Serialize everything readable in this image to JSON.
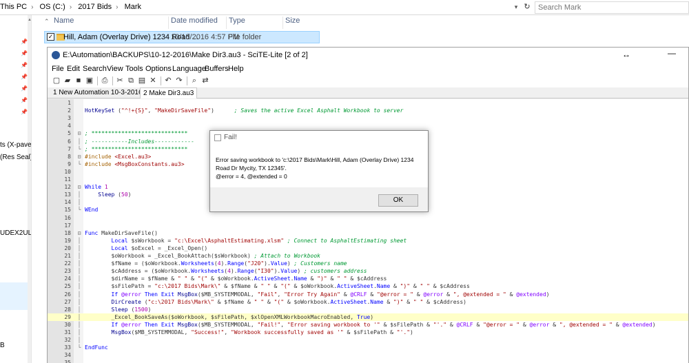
{
  "explorer": {
    "breadcrumbs": [
      "This PC",
      "OS (C:)",
      "2017 Bids",
      "Mark"
    ],
    "search_placeholder": "Search Mark",
    "columns": [
      "Name",
      "Date modified",
      "Type",
      "Size"
    ],
    "files": [
      {
        "name": "Hill, Adam (Overlay Drive) 1234 Road ...",
        "date": "10/13/2016 4:57 PM",
        "type": "File folder"
      }
    ],
    "nav_fragments": [
      "ts (X-pave a",
      "(Res Seal)",
      "UDEX2ULTI",
      "B"
    ]
  },
  "scite": {
    "title": "E:\\Automation\\BACKUPS\\10-12-2016\\Make Dir3.au3 - SciTE-Lite [2 of 2]",
    "menus": [
      "File",
      "Edit",
      "Search",
      "View",
      "Tools",
      "Options",
      "Language",
      "Buffers",
      "Help"
    ],
    "tabs": [
      "1 New Automation 10-3-2016.au3",
      "2 Make Dir3.au3"
    ],
    "active_tab": 1,
    "highlighted_line": 29,
    "lines": [
      {
        "n": "1",
        "fold": "",
        "tokens": []
      },
      {
        "n": "2",
        "fold": "",
        "tokens": [
          [
            "fn",
            "HotKeySet"
          ],
          [
            "txt",
            " ("
          ],
          [
            "str",
            "\"^!+{S}\""
          ],
          [
            "txt",
            ", "
          ],
          [
            "str",
            "\"MakeDirSaveFile\""
          ],
          [
            "txt",
            ")      "
          ],
          [
            "com",
            "; Saves the active Excel Asphalt Workbook to server"
          ]
        ]
      },
      {
        "n": "3",
        "fold": "",
        "tokens": []
      },
      {
        "n": "4",
        "fold": "",
        "tokens": []
      },
      {
        "n": "5",
        "fold": "⊟",
        "tokens": [
          [
            "com",
            "; *****************************"
          ]
        ]
      },
      {
        "n": "6",
        "fold": "│",
        "tokens": [
          [
            "com",
            "; -----------Includes------------"
          ]
        ]
      },
      {
        "n": "7",
        "fold": "└",
        "tokens": [
          [
            "com",
            "; *****************************"
          ]
        ]
      },
      {
        "n": "8",
        "fold": "⊟",
        "tokens": [
          [
            "inc",
            "#include"
          ],
          [
            "txt",
            " "
          ],
          [
            "str",
            "<Excel.au3>"
          ]
        ]
      },
      {
        "n": "9",
        "fold": "└",
        "tokens": [
          [
            "inc",
            "#include"
          ],
          [
            "txt",
            " "
          ],
          [
            "str",
            "<MsgBoxConstants.au3>"
          ]
        ]
      },
      {
        "n": "10",
        "fold": "",
        "tokens": []
      },
      {
        "n": "11",
        "fold": "",
        "tokens": []
      },
      {
        "n": "12",
        "fold": "⊟",
        "tokens": [
          [
            "kw",
            "While"
          ],
          [
            "txt",
            " "
          ],
          [
            "num",
            "1"
          ]
        ]
      },
      {
        "n": "13",
        "fold": "│",
        "tokens": [
          [
            "txt",
            "    "
          ],
          [
            "fn",
            "Sleep"
          ],
          [
            "txt",
            " ("
          ],
          [
            "num",
            "50"
          ],
          [
            "txt",
            ")"
          ]
        ]
      },
      {
        "n": "14",
        "fold": "│",
        "tokens": []
      },
      {
        "n": "15",
        "fold": "└",
        "tokens": [
          [
            "kw",
            "WEnd"
          ]
        ]
      },
      {
        "n": "16",
        "fold": "",
        "tokens": []
      },
      {
        "n": "17",
        "fold": "",
        "tokens": []
      },
      {
        "n": "18",
        "fold": "⊟",
        "tokens": [
          [
            "kw",
            "Func"
          ],
          [
            "txt",
            " MakeDirSaveFile()"
          ]
        ]
      },
      {
        "n": "19",
        "fold": "│",
        "tokens": [
          [
            "txt",
            "        "
          ],
          [
            "kw",
            "Local"
          ],
          [
            "txt",
            " $sWorkbook = "
          ],
          [
            "str",
            "\"c:\\Excel\\AsphaltEstimating.xlsm\""
          ],
          [
            "txt",
            " "
          ],
          [
            "com",
            "; Connect to AsphaltEstimating sheet"
          ]
        ]
      },
      {
        "n": "20",
        "fold": "│",
        "tokens": [
          [
            "txt",
            "        "
          ],
          [
            "kw",
            "Local"
          ],
          [
            "txt",
            " $oExcel = _Excel_Open()"
          ]
        ]
      },
      {
        "n": "21",
        "fold": "│",
        "tokens": [
          [
            "txt",
            "        $oWorkbook = _Excel_BookAttach($sWorkbook) "
          ],
          [
            "com",
            "; Attach to Workbook"
          ]
        ]
      },
      {
        "n": "22",
        "fold": "│",
        "tokens": [
          [
            "txt",
            "        $fName = ($oWorkbook."
          ],
          [
            "kw",
            "Worksheets"
          ],
          [
            "txt",
            "("
          ],
          [
            "num",
            "4"
          ],
          [
            "txt",
            ")."
          ],
          [
            "kw",
            "Range"
          ],
          [
            "txt",
            "("
          ],
          [
            "str",
            "\"J20\""
          ],
          [
            "txt",
            ")."
          ],
          [
            "kw",
            "Value"
          ],
          [
            "txt",
            ") "
          ],
          [
            "com",
            "; Customers name"
          ]
        ]
      },
      {
        "n": "23",
        "fold": "│",
        "tokens": [
          [
            "txt",
            "        $cAddress = ($oWorkbook."
          ],
          [
            "kw",
            "Worksheets"
          ],
          [
            "txt",
            "("
          ],
          [
            "num",
            "4"
          ],
          [
            "txt",
            ")."
          ],
          [
            "kw",
            "Range"
          ],
          [
            "txt",
            "("
          ],
          [
            "str",
            "\"I30\""
          ],
          [
            "txt",
            ")."
          ],
          [
            "kw",
            "Value"
          ],
          [
            "txt",
            ") "
          ],
          [
            "com",
            "; customers address"
          ]
        ]
      },
      {
        "n": "24",
        "fold": "│",
        "tokens": [
          [
            "txt",
            "        $dirName = $fName & "
          ],
          [
            "str",
            "\" \""
          ],
          [
            "txt",
            " & "
          ],
          [
            "str",
            "\"(\""
          ],
          [
            "txt",
            " & $oWorkbook."
          ],
          [
            "kw",
            "ActiveSheet"
          ],
          [
            "txt",
            "."
          ],
          [
            "kw",
            "Name"
          ],
          [
            "txt",
            " & "
          ],
          [
            "str",
            "\")\""
          ],
          [
            "txt",
            " & "
          ],
          [
            "str",
            "\" \""
          ],
          [
            "txt",
            " & $cAddress"
          ]
        ]
      },
      {
        "n": "25",
        "fold": "│",
        "tokens": [
          [
            "txt",
            "        $sFilePath = "
          ],
          [
            "str",
            "\"c:\\2017 Bids\\Mark\\\""
          ],
          [
            "txt",
            " & $fName & "
          ],
          [
            "str",
            "\" \""
          ],
          [
            "txt",
            " & "
          ],
          [
            "str",
            "\"(\""
          ],
          [
            "txt",
            " & $oWorkbook."
          ],
          [
            "kw",
            "ActiveSheet"
          ],
          [
            "txt",
            "."
          ],
          [
            "kw",
            "Name"
          ],
          [
            "txt",
            " & "
          ],
          [
            "str",
            "\")\""
          ],
          [
            "txt",
            " & "
          ],
          [
            "str",
            "\" \""
          ],
          [
            "txt",
            " & $cAddress"
          ]
        ]
      },
      {
        "n": "26",
        "fold": "│",
        "tokens": [
          [
            "txt",
            "        "
          ],
          [
            "kw",
            "If"
          ],
          [
            "txt",
            " "
          ],
          [
            "mac",
            "@error"
          ],
          [
            "txt",
            " "
          ],
          [
            "kw",
            "Then Exit"
          ],
          [
            "txt",
            " "
          ],
          [
            "fn",
            "MsgBox"
          ],
          [
            "txt",
            "($MB_SYSTEMMODAL, "
          ],
          [
            "str",
            "\"Fail\""
          ],
          [
            "txt",
            ", "
          ],
          [
            "str",
            "\"Error Try Again\""
          ],
          [
            "txt",
            " & "
          ],
          [
            "mac",
            "@CRLF"
          ],
          [
            "txt",
            " & "
          ],
          [
            "str",
            "\"@error = \""
          ],
          [
            "txt",
            " & "
          ],
          [
            "mac",
            "@error"
          ],
          [
            "txt",
            " & "
          ],
          [
            "str",
            "\", @extended = \""
          ],
          [
            "txt",
            " & "
          ],
          [
            "mac",
            "@extended"
          ],
          [
            "txt",
            ")"
          ]
        ]
      },
      {
        "n": "27",
        "fold": "│",
        "tokens": [
          [
            "txt",
            "        "
          ],
          [
            "fn",
            "DirCreate"
          ],
          [
            "txt",
            " ("
          ],
          [
            "str",
            "\"c:\\2017 Bids\\Mark\\\""
          ],
          [
            "txt",
            " & $fName & "
          ],
          [
            "str",
            "\" \""
          ],
          [
            "txt",
            " & "
          ],
          [
            "str",
            "\"(\""
          ],
          [
            "txt",
            " & $oWorkbook."
          ],
          [
            "kw",
            "ActiveSheet"
          ],
          [
            "txt",
            "."
          ],
          [
            "kw",
            "Name"
          ],
          [
            "txt",
            " & "
          ],
          [
            "str",
            "\")\""
          ],
          [
            "txt",
            " & "
          ],
          [
            "str",
            "\" \""
          ],
          [
            "txt",
            " & $cAddress)"
          ]
        ]
      },
      {
        "n": "28",
        "fold": "│",
        "tokens": [
          [
            "txt",
            "        "
          ],
          [
            "fn",
            "Sleep"
          ],
          [
            "txt",
            " ("
          ],
          [
            "num",
            "1500"
          ],
          [
            "txt",
            ")"
          ]
        ]
      },
      {
        "n": "29",
        "fold": "│",
        "tokens": [
          [
            "txt",
            "        _Excel_BookSaveAs($oWorkbook, $sFilePath, $xlOpenXMLWorkbookMacroEnabled, "
          ],
          [
            "kw",
            "True"
          ],
          [
            "txt",
            ")"
          ]
        ]
      },
      {
        "n": "30",
        "fold": "│",
        "tokens": [
          [
            "txt",
            "        "
          ],
          [
            "kw",
            "If"
          ],
          [
            "txt",
            " "
          ],
          [
            "mac",
            "@error"
          ],
          [
            "txt",
            " "
          ],
          [
            "kw",
            "Then Exit"
          ],
          [
            "txt",
            " "
          ],
          [
            "fn",
            "MsgBox"
          ],
          [
            "txt",
            "($MB_SYSTEMMODAL, "
          ],
          [
            "str",
            "\"Fail!\""
          ],
          [
            "txt",
            ", "
          ],
          [
            "str",
            "\"Error saving workbook to '\""
          ],
          [
            "txt",
            " & $sFilePath & "
          ],
          [
            "str",
            "\"'.\""
          ],
          [
            "txt",
            " & "
          ],
          [
            "mac",
            "@CRLF"
          ],
          [
            "txt",
            " & "
          ],
          [
            "str",
            "\"@error = \""
          ],
          [
            "txt",
            " & "
          ],
          [
            "mac",
            "@error"
          ],
          [
            "txt",
            " & "
          ],
          [
            "str",
            "\", @extended = \""
          ],
          [
            "txt",
            " & "
          ],
          [
            "mac",
            "@extended"
          ],
          [
            "txt",
            ")"
          ]
        ]
      },
      {
        "n": "31",
        "fold": "│",
        "tokens": [
          [
            "txt",
            "        "
          ],
          [
            "fn",
            "MsgBox"
          ],
          [
            "txt",
            "($MB_SYSTEMMODAL, "
          ],
          [
            "str",
            "\"Success!\""
          ],
          [
            "txt",
            ", "
          ],
          [
            "str",
            "\"Workbook successfully saved as '\""
          ],
          [
            "txt",
            " & $sFilePath & "
          ],
          [
            "str",
            "\"'.\""
          ],
          [
            "txt",
            ")"
          ]
        ]
      },
      {
        "n": "32",
        "fold": "│",
        "tokens": []
      },
      {
        "n": "33",
        "fold": "└",
        "tokens": [
          [
            "kw",
            "EndFunc"
          ]
        ]
      },
      {
        "n": "34",
        "fold": "",
        "tokens": []
      },
      {
        "n": "35",
        "fold": "",
        "tokens": []
      }
    ]
  },
  "dialog": {
    "title": "Fail!",
    "message_line1": "Error saving workbook to 'c:\\2017 Bids\\Mark\\Hill, Adam (Overlay Drive) 1234",
    "message_line2": "Road Dr Mycity, TX 12345'.",
    "message_line3": "@error = 4, @extended = 0",
    "ok_label": "OK"
  }
}
